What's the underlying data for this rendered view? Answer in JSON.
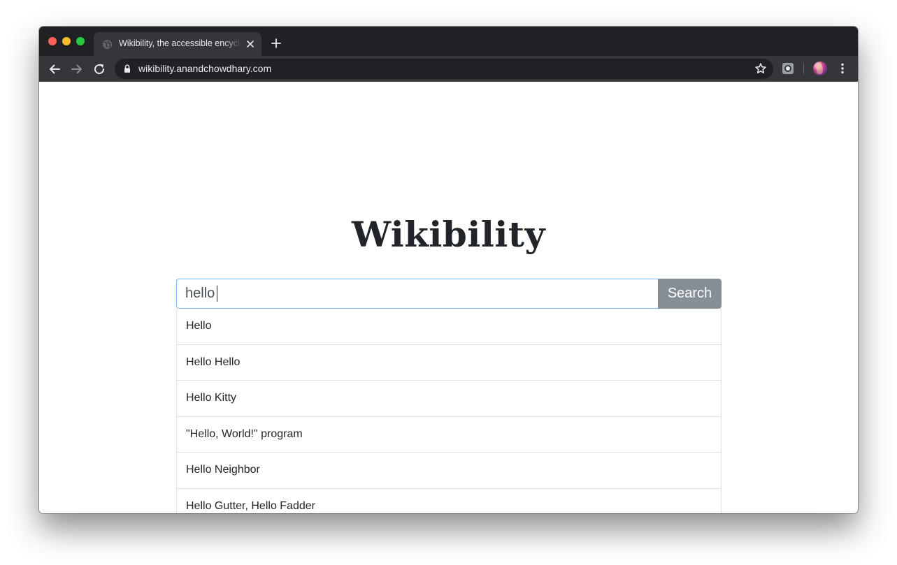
{
  "browser": {
    "tab_title": "Wikibility, the accessible encyclopedia",
    "url": "wikibility.anandchowdhary.com"
  },
  "page": {
    "site_title": "Wikibility",
    "search": {
      "value": "hello",
      "button_label": "Search"
    },
    "suggestions": [
      "Hello",
      "Hello Hello",
      "Hello Kitty",
      "\"Hello, World!\" program",
      "Hello Neighbor",
      "Hello Gutter, Hello Fadder"
    ]
  },
  "colors": {
    "tab_strip": "#202124",
    "toolbar": "#35363a",
    "search_button": "#868e96",
    "input_focus_border": "#80bdff"
  }
}
